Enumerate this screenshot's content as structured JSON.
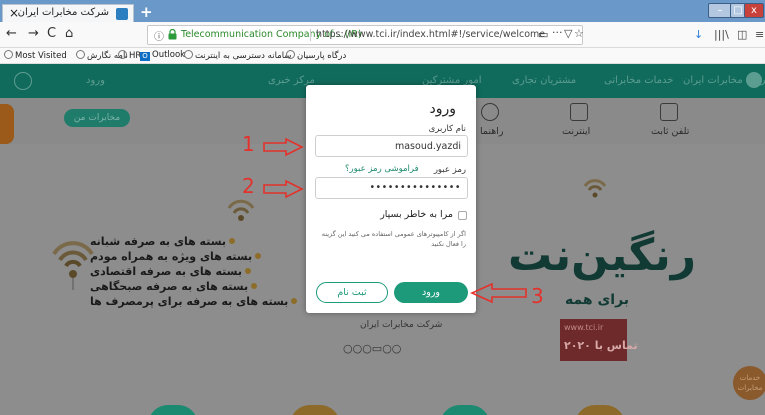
{
  "browser": {
    "tab_title": "شرکت مخابرات ایران",
    "tab_close": "×",
    "new_tab": "+",
    "window_controls": {
      "minimize": "–",
      "maximize": "□",
      "close": "x"
    },
    "nav_buttons": {
      "back": "←",
      "forward": "→",
      "reload": "C",
      "home": "⌂"
    },
    "url": {
      "info": "ⓘ",
      "site": "Telecommunication Company of... (IR)",
      "path": "https://www.tci.ir/index.html#!/service/welcome",
      "icons": {
        "reader": "▭",
        "more": "···",
        "pocket": "▽",
        "star": "☆"
      }
    },
    "toolbar": {
      "download": "↓",
      "library": "|||\\",
      "sidebar": "◫",
      "menu": "≡"
    },
    "bookmarks": [
      "Most Visited",
      "نامه نگارش",
      "HR",
      "Outlook",
      "سامانه دسترسی به اینترنت",
      "درگاه پارسیان"
    ]
  },
  "site_nav": {
    "login": "ورود",
    "items": [
      "شرکت مخابرات ایران",
      "خدمات مخابراتی",
      "مشتریان تجاری",
      "امور مشترکین",
      "مرکز خبری"
    ]
  },
  "sub_nav": {
    "gov_button": "مخابرات من",
    "items": [
      "تلفن ثابت",
      "اینترنت",
      "راهنما"
    ]
  },
  "hero": {
    "bullets": [
      "بسته های به صرفه شبانه",
      "بسته های ویژه به همراه مودم",
      "بسته های به صرفه اقتصادی",
      "بسته های به صرفه صبحگاهی",
      "بسته های به صرفه برای پرمصرف ها"
    ],
    "big_title": "رنگین‌نت",
    "sub_title": "برای همه",
    "promo_url": "www.tci.ir",
    "promo_text": "تماس با ۲۰۲۰",
    "side_badge": "خدمات\nمخابرات",
    "brand_mark": "شرکت مخابرات ایران",
    "carousel": "○○○▭○○"
  },
  "login_modal": {
    "title": "ورود",
    "username_label": "نام کاربری",
    "username_value": "masoud.yazdi",
    "password_label": "رمز عبور",
    "forgot_link": "فراموشی رمز عبور؟",
    "password_value": "•••••••••••••••",
    "remember_label": "مرا به خاطر بسپار",
    "remember_note": "اگر از کامپیوترهای عمومی استفاده می کنید این گزینه را فعال نکنید",
    "login_button": "ورود",
    "signup_button": "ثبت نام"
  },
  "annotations": [
    "1",
    "2",
    "3"
  ],
  "colors": {
    "accent": "#1d9a7a",
    "annotation": "#e4312b",
    "nav": "#116b5c"
  }
}
